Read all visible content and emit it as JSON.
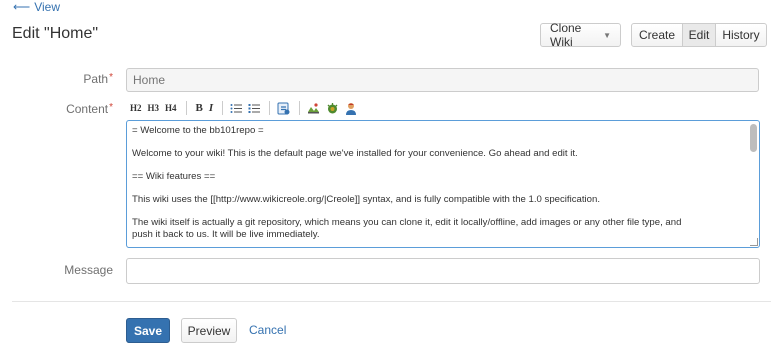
{
  "nav": {
    "back_label": "View"
  },
  "header": {
    "title": "Edit \"Home\""
  },
  "actions": {
    "clone_label": "Clone Wiki",
    "create_label": "Create",
    "edit_label": "Edit",
    "history_label": "History"
  },
  "form": {
    "path_label": "Path",
    "path_placeholder": "Home",
    "content_label": "Content",
    "message_label": "Message",
    "message_value": "",
    "content_lines": [
      "= Welcome to the bb101repo =",
      "Welcome to your wiki! This is the default page we've installed for your convenience. Go ahead and edit it.",
      "== Wiki features ==",
      "This wiki uses the [[http://www.wikicreole.org/|Creole]] syntax, and is fully compatible with the 1.0 specification.",
      "The wiki itself is actually a git repository, which means you can clone it, edit it locally/offline, add images or any other file type, and\npush it back to us. It will be live immediately."
    ]
  },
  "toolbar": {
    "h2": "H2",
    "h3": "H3",
    "h4": "H4",
    "bold": "B",
    "italic": "I"
  },
  "footer": {
    "save_label": "Save",
    "preview_label": "Preview",
    "cancel_label": "Cancel"
  },
  "colors": {
    "accent": "#3572b0",
    "required": "#d04437",
    "focus_border": "#5b9dd9"
  }
}
